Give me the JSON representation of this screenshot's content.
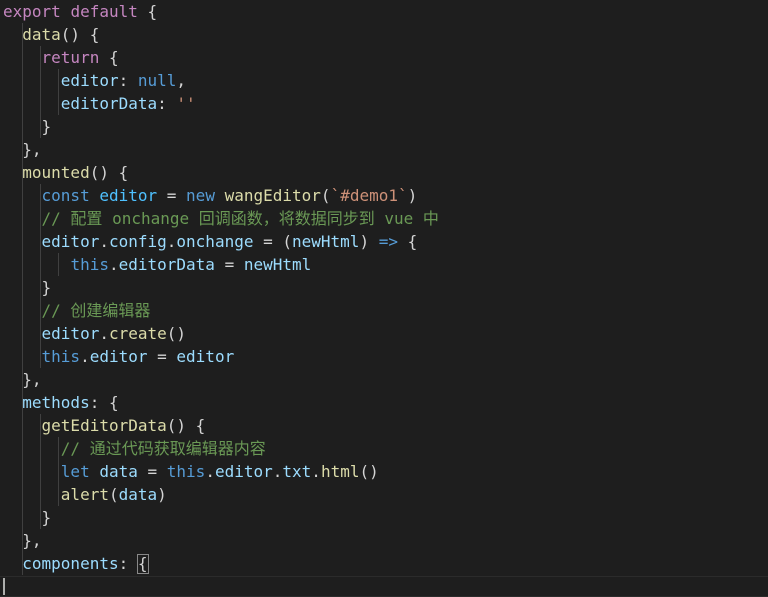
{
  "editor": {
    "background": "#1e1e1e",
    "lines": [
      {
        "tokens": [
          {
            "t": "export",
            "c": "ctl"
          },
          {
            "t": " ",
            "c": "pun"
          },
          {
            "t": "default",
            "c": "ctl"
          },
          {
            "t": " {",
            "c": "pun"
          }
        ]
      },
      {
        "tokens": [
          {
            "t": "  ",
            "c": "pun"
          },
          {
            "t": "data",
            "c": "fn"
          },
          {
            "t": "() {",
            "c": "pun"
          }
        ]
      },
      {
        "tokens": [
          {
            "t": "    ",
            "c": "pun"
          },
          {
            "t": "return",
            "c": "ctl"
          },
          {
            "t": " {",
            "c": "pun"
          }
        ]
      },
      {
        "tokens": [
          {
            "t": "      ",
            "c": "pun"
          },
          {
            "t": "editor",
            "c": "prop"
          },
          {
            "t": ": ",
            "c": "pun"
          },
          {
            "t": "null",
            "c": "kw"
          },
          {
            "t": ",",
            "c": "pun"
          }
        ]
      },
      {
        "tokens": [
          {
            "t": "      ",
            "c": "pun"
          },
          {
            "t": "editorData",
            "c": "prop"
          },
          {
            "t": ": ",
            "c": "pun"
          },
          {
            "t": "''",
            "c": "str"
          }
        ]
      },
      {
        "tokens": [
          {
            "t": "    }",
            "c": "pun"
          }
        ]
      },
      {
        "tokens": [
          {
            "t": "  },",
            "c": "pun"
          }
        ]
      },
      {
        "tokens": [
          {
            "t": "  ",
            "c": "pun"
          },
          {
            "t": "mounted",
            "c": "fn"
          },
          {
            "t": "() {",
            "c": "pun"
          }
        ]
      },
      {
        "tokens": [
          {
            "t": "    ",
            "c": "pun"
          },
          {
            "t": "const",
            "c": "kw"
          },
          {
            "t": " ",
            "c": "pun"
          },
          {
            "t": "editor",
            "c": "var"
          },
          {
            "t": " = ",
            "c": "pun"
          },
          {
            "t": "new",
            "c": "kw"
          },
          {
            "t": " ",
            "c": "pun"
          },
          {
            "t": "wangEditor",
            "c": "fn"
          },
          {
            "t": "(",
            "c": "pun"
          },
          {
            "t": "`#demo1`",
            "c": "str"
          },
          {
            "t": ")",
            "c": "pun"
          }
        ]
      },
      {
        "tokens": [
          {
            "t": "    ",
            "c": "pun"
          },
          {
            "t": "// 配置 onchange 回调函数，将数据同步到 vue 中",
            "c": "cmt"
          }
        ]
      },
      {
        "tokens": [
          {
            "t": "    ",
            "c": "pun"
          },
          {
            "t": "editor",
            "c": "prop"
          },
          {
            "t": ".",
            "c": "pun"
          },
          {
            "t": "config",
            "c": "prop"
          },
          {
            "t": ".",
            "c": "pun"
          },
          {
            "t": "onchange",
            "c": "prop"
          },
          {
            "t": " = (",
            "c": "pun"
          },
          {
            "t": "newHtml",
            "c": "prop"
          },
          {
            "t": ") ",
            "c": "pun"
          },
          {
            "t": "=>",
            "c": "kw"
          },
          {
            "t": " {",
            "c": "pun"
          }
        ]
      },
      {
        "tokens": [
          {
            "t": "       ",
            "c": "pun"
          },
          {
            "t": "this",
            "c": "kw"
          },
          {
            "t": ".",
            "c": "pun"
          },
          {
            "t": "editorData",
            "c": "prop"
          },
          {
            "t": " = ",
            "c": "pun"
          },
          {
            "t": "newHtml",
            "c": "prop"
          }
        ]
      },
      {
        "tokens": [
          {
            "t": "    }",
            "c": "pun"
          }
        ]
      },
      {
        "tokens": [
          {
            "t": "    ",
            "c": "pun"
          },
          {
            "t": "// 创建编辑器",
            "c": "cmt"
          }
        ]
      },
      {
        "tokens": [
          {
            "t": "    ",
            "c": "pun"
          },
          {
            "t": "editor",
            "c": "prop"
          },
          {
            "t": ".",
            "c": "pun"
          },
          {
            "t": "create",
            "c": "fn"
          },
          {
            "t": "()",
            "c": "pun"
          }
        ]
      },
      {
        "tokens": [
          {
            "t": "    ",
            "c": "pun"
          },
          {
            "t": "this",
            "c": "kw"
          },
          {
            "t": ".",
            "c": "pun"
          },
          {
            "t": "editor",
            "c": "prop"
          },
          {
            "t": " = ",
            "c": "pun"
          },
          {
            "t": "editor",
            "c": "prop"
          }
        ]
      },
      {
        "tokens": [
          {
            "t": "  },",
            "c": "pun"
          }
        ]
      },
      {
        "tokens": [
          {
            "t": "  ",
            "c": "pun"
          },
          {
            "t": "methods",
            "c": "prop"
          },
          {
            "t": ": {",
            "c": "pun"
          }
        ]
      },
      {
        "tokens": [
          {
            "t": "    ",
            "c": "pun"
          },
          {
            "t": "getEditorData",
            "c": "fn"
          },
          {
            "t": "() {",
            "c": "pun"
          }
        ]
      },
      {
        "tokens": [
          {
            "t": "      ",
            "c": "pun"
          },
          {
            "t": "// 通过代码获取编辑器内容",
            "c": "cmt"
          }
        ]
      },
      {
        "tokens": [
          {
            "t": "      ",
            "c": "pun"
          },
          {
            "t": "let",
            "c": "kw"
          },
          {
            "t": " ",
            "c": "pun"
          },
          {
            "t": "data",
            "c": "prop"
          },
          {
            "t": " = ",
            "c": "pun"
          },
          {
            "t": "this",
            "c": "kw"
          },
          {
            "t": ".",
            "c": "pun"
          },
          {
            "t": "editor",
            "c": "prop"
          },
          {
            "t": ".",
            "c": "pun"
          },
          {
            "t": "txt",
            "c": "prop"
          },
          {
            "t": ".",
            "c": "pun"
          },
          {
            "t": "html",
            "c": "fn"
          },
          {
            "t": "()",
            "c": "pun"
          }
        ]
      },
      {
        "tokens": [
          {
            "t": "      ",
            "c": "pun"
          },
          {
            "t": "alert",
            "c": "fn"
          },
          {
            "t": "(",
            "c": "pun"
          },
          {
            "t": "data",
            "c": "prop"
          },
          {
            "t": ")",
            "c": "pun"
          }
        ]
      },
      {
        "tokens": [
          {
            "t": "    }",
            "c": "pun"
          }
        ]
      },
      {
        "tokens": [
          {
            "t": "  },",
            "c": "pun"
          }
        ]
      },
      {
        "tokens": [
          {
            "t": "  ",
            "c": "pun"
          },
          {
            "t": "components",
            "c": "prop"
          },
          {
            "t": ": ",
            "c": "pun"
          },
          {
            "t": "{",
            "c": "box"
          }
        ]
      }
    ]
  },
  "colors": {
    "keyword": "#569cd6",
    "control": "#c586c0",
    "function": "#dcdcaa",
    "property": "#9cdcfe",
    "string": "#ce9178",
    "comment": "#6a9955",
    "punctuation": "#d4d4d4"
  }
}
